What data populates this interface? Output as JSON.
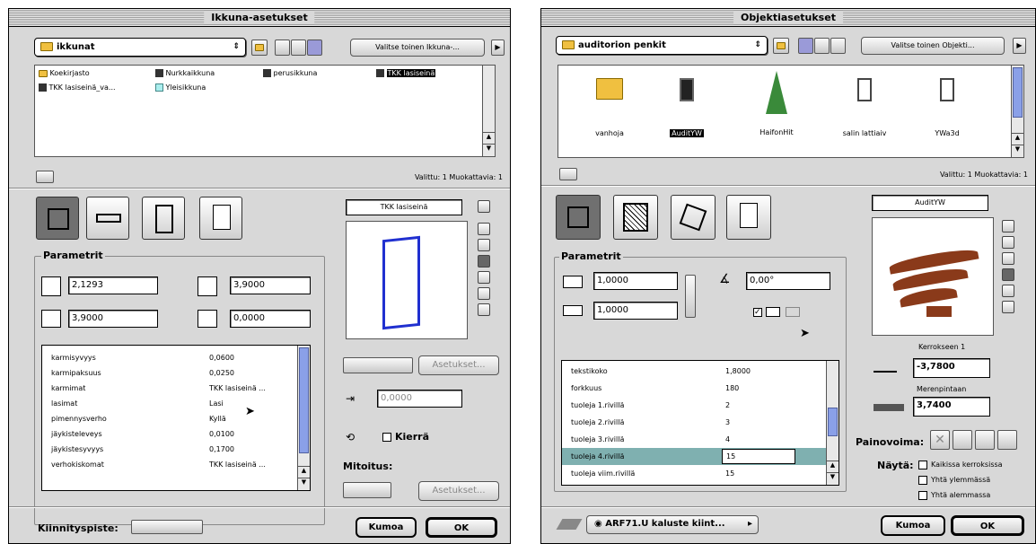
{
  "left": {
    "title": "Ikkuna-asetukset",
    "library": "ikkunat",
    "choose_btn": "Valitse toinen Ikkuna-...",
    "items": [
      "Koekirjasto",
      "Nurkkaikkuna",
      "perusikkuna",
      "TKK lasiseinä",
      "TKK lasiseinä_va...",
      "Yleisikkuna"
    ],
    "status": "Valittu: 1 Muokattavia: 1",
    "param_title": "Parametrit",
    "width": "2,1293",
    "height": "3,9000",
    "height2": "3,9000",
    "sill": "0,0000",
    "preview_name": "TKK lasiseinä",
    "params": [
      {
        "k": "karmisyvyys",
        "v": "0,0600"
      },
      {
        "k": "karmipaksuus",
        "v": "0,0250"
      },
      {
        "k": "karmimat",
        "v": "TKK lasiseinä ..."
      },
      {
        "k": "lasimat",
        "v": "Lasi"
      },
      {
        "k": "pimennysverho",
        "v": "Kyllä"
      },
      {
        "k": "jäykisteleveys",
        "v": "0,0100"
      },
      {
        "k": "jäykistesyvyys",
        "v": "0,1700"
      },
      {
        "k": "verhokiskomat",
        "v": "TKK lasiseinä ..."
      }
    ],
    "settings1": "Asetukset...",
    "offset": "0,0000",
    "rotate": "Kierrä",
    "dims": "Mitoitus:",
    "settings2": "Asetukset...",
    "anchor": "Kiinnityspiste:",
    "cancel": "Kumoa",
    "ok": "OK"
  },
  "right": {
    "title": "Objektiasetukset",
    "library": "auditorion penkit",
    "choose_btn": "Valitse toinen Objekti...",
    "items": [
      "vanhoja",
      "AuditYW",
      "HaifonHit",
      "salin lattiaiv",
      "YWa3d"
    ],
    "status": "Valittu: 1 Muokattavia: 1",
    "param_title": "Parametrit",
    "x": "1,0000",
    "y": "1,0000",
    "angle": "0,00°",
    "preview_name": "AuditYW",
    "params": [
      {
        "k": "tekstikoko",
        "v": "1,8000"
      },
      {
        "k": "forkkuus",
        "v": "180"
      },
      {
        "k": "tuoleja 1.rivillä",
        "v": "2"
      },
      {
        "k": "tuoleja 2.rivillä",
        "v": "3"
      },
      {
        "k": "tuoleja 3.rivillä",
        "v": "4"
      },
      {
        "k": "tuoleja 4.rivillä",
        "v": "15"
      },
      {
        "k": "tuoleja viim.rivillä",
        "v": "15"
      }
    ],
    "floor_lbl": "Kerrokseen 1",
    "elev": "-3,7800",
    "sea_lbl": "Merenpintaan",
    "sea": "3,7400",
    "gravity": "Painovoima:",
    "show": "Näytä:",
    "show_opts": [
      "Kaikissa kerroksissa",
      "Yhtä ylemmässä",
      "Yhtä alemmassa"
    ],
    "layer": "ARF71.U kaluste kiint...",
    "cancel": "Kumoa",
    "ok": "OK"
  }
}
